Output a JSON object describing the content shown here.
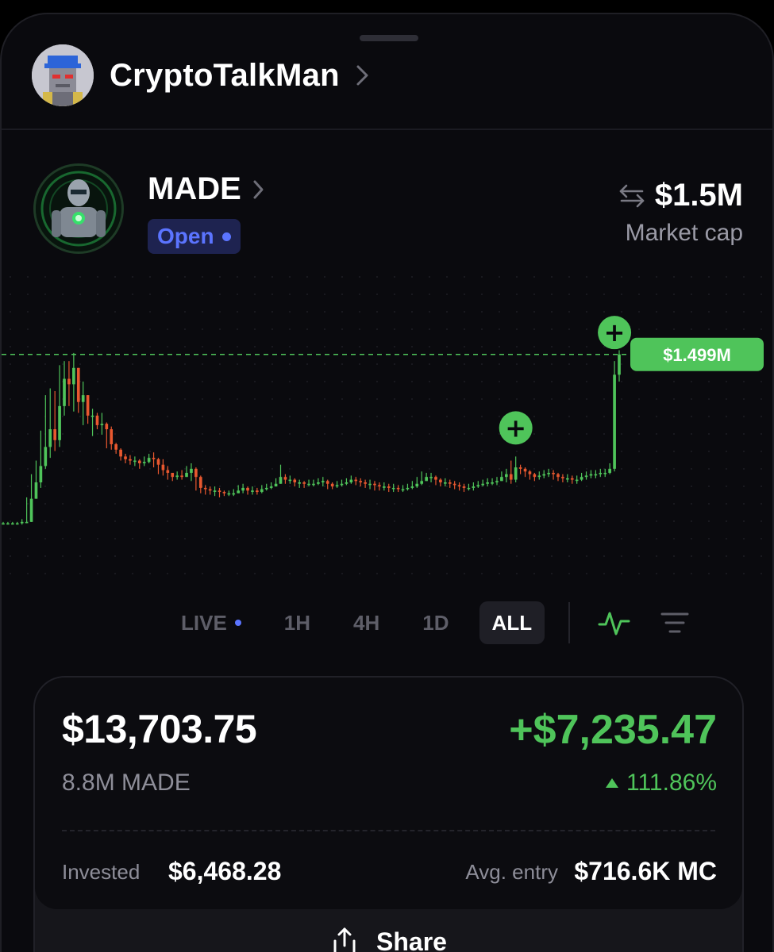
{
  "header": {
    "username": "CryptoTalkMan"
  },
  "token": {
    "ticker": "MADE",
    "status": "Open",
    "market_cap": "$1.5M",
    "market_cap_label": "Market cap"
  },
  "chart_data": {
    "type": "candlestick",
    "current_price_label": "$1.499M",
    "current_price": 1.499,
    "buy_markers": [
      {
        "index": 109,
        "label": "+"
      },
      {
        "index": 130,
        "label": "+"
      }
    ],
    "close": [
      0.26,
      0.26,
      0.26,
      0.26,
      0.27,
      0.27,
      0.44,
      0.56,
      0.68,
      0.82,
      0.95,
      0.87,
      1.12,
      1.32,
      1.28,
      1.4,
      1.15,
      1.2,
      1.05,
      1.05,
      0.98,
      0.99,
      0.95,
      0.84,
      0.8,
      0.75,
      0.73,
      0.72,
      0.72,
      0.7,
      0.71,
      0.74,
      0.73,
      0.69,
      0.65,
      0.63,
      0.6,
      0.61,
      0.6,
      0.63,
      0.66,
      0.6,
      0.52,
      0.51,
      0.5,
      0.5,
      0.49,
      0.48,
      0.48,
      0.48,
      0.5,
      0.52,
      0.5,
      0.5,
      0.49,
      0.51,
      0.52,
      0.53,
      0.55,
      0.6,
      0.58,
      0.58,
      0.56,
      0.56,
      0.55,
      0.55,
      0.55,
      0.56,
      0.57,
      0.55,
      0.53,
      0.54,
      0.55,
      0.56,
      0.58,
      0.57,
      0.56,
      0.55,
      0.55,
      0.54,
      0.53,
      0.53,
      0.52,
      0.52,
      0.51,
      0.51,
      0.52,
      0.53,
      0.55,
      0.57,
      0.6,
      0.6,
      0.58,
      0.56,
      0.56,
      0.55,
      0.54,
      0.53,
      0.52,
      0.52,
      0.53,
      0.54,
      0.55,
      0.56,
      0.56,
      0.57,
      0.6,
      0.62,
      0.58,
      0.67,
      0.66,
      0.64,
      0.62,
      0.6,
      0.61,
      0.62,
      0.63,
      0.62,
      0.6,
      0.59,
      0.59,
      0.58,
      0.58,
      0.6,
      0.61,
      0.62,
      0.62,
      0.63,
      0.63,
      0.66,
      1.35,
      1.499
    ],
    "high": [
      0.27,
      0.27,
      0.27,
      0.27,
      0.29,
      0.45,
      0.62,
      0.72,
      0.94,
      1.2,
      1.25,
      1.23,
      1.42,
      1.45,
      1.45,
      1.51,
      1.34,
      1.3,
      1.18,
      1.1,
      1.07,
      1.07,
      1.0,
      0.97,
      0.85,
      0.81,
      0.77,
      0.76,
      0.75,
      0.73,
      0.75,
      0.77,
      0.78,
      0.74,
      0.73,
      0.68,
      0.63,
      0.64,
      0.65,
      0.68,
      0.7,
      0.67,
      0.61,
      0.54,
      0.53,
      0.53,
      0.52,
      0.5,
      0.5,
      0.51,
      0.54,
      0.55,
      0.53,
      0.53,
      0.52,
      0.54,
      0.55,
      0.56,
      0.59,
      0.69,
      0.62,
      0.61,
      0.59,
      0.58,
      0.57,
      0.58,
      0.58,
      0.59,
      0.6,
      0.58,
      0.56,
      0.57,
      0.58,
      0.59,
      0.61,
      0.6,
      0.59,
      0.58,
      0.58,
      0.57,
      0.56,
      0.56,
      0.55,
      0.55,
      0.54,
      0.54,
      0.55,
      0.57,
      0.6,
      0.64,
      0.63,
      0.63,
      0.61,
      0.59,
      0.59,
      0.58,
      0.57,
      0.56,
      0.55,
      0.55,
      0.56,
      0.57,
      0.58,
      0.59,
      0.59,
      0.6,
      0.64,
      0.66,
      0.72,
      0.75,
      0.69,
      0.67,
      0.65,
      0.63,
      0.64,
      0.65,
      0.66,
      0.65,
      0.63,
      0.62,
      0.62,
      0.61,
      0.61,
      0.63,
      0.64,
      0.65,
      0.65,
      0.66,
      0.66,
      0.7,
      1.45,
      1.53
    ],
    "low": [
      0.25,
      0.25,
      0.25,
      0.25,
      0.25,
      0.26,
      0.3,
      0.44,
      0.52,
      0.66,
      0.74,
      0.79,
      0.82,
      1.05,
      1.12,
      1.08,
      1.07,
      0.98,
      0.99,
      0.9,
      0.95,
      0.91,
      0.81,
      0.8,
      0.77,
      0.72,
      0.7,
      0.69,
      0.68,
      0.66,
      0.68,
      0.7,
      0.67,
      0.62,
      0.61,
      0.58,
      0.57,
      0.58,
      0.58,
      0.6,
      0.57,
      0.5,
      0.48,
      0.47,
      0.47,
      0.46,
      0.45,
      0.46,
      0.46,
      0.46,
      0.48,
      0.48,
      0.47,
      0.47,
      0.47,
      0.48,
      0.5,
      0.51,
      0.53,
      0.55,
      0.55,
      0.55,
      0.53,
      0.52,
      0.52,
      0.53,
      0.53,
      0.54,
      0.53,
      0.51,
      0.51,
      0.52,
      0.53,
      0.54,
      0.55,
      0.54,
      0.53,
      0.52,
      0.51,
      0.5,
      0.5,
      0.5,
      0.49,
      0.49,
      0.49,
      0.49,
      0.5,
      0.51,
      0.52,
      0.54,
      0.57,
      0.56,
      0.54,
      0.53,
      0.53,
      0.52,
      0.51,
      0.5,
      0.49,
      0.5,
      0.5,
      0.52,
      0.53,
      0.53,
      0.54,
      0.54,
      0.57,
      0.56,
      0.55,
      0.56,
      0.62,
      0.6,
      0.58,
      0.57,
      0.58,
      0.59,
      0.6,
      0.58,
      0.57,
      0.56,
      0.56,
      0.55,
      0.55,
      0.57,
      0.58,
      0.59,
      0.59,
      0.6,
      0.6,
      0.62,
      0.64,
      1.3
    ]
  },
  "timeframes": {
    "live": "LIVE",
    "h1": "1H",
    "h4": "4H",
    "d1": "1D",
    "all": "ALL",
    "active": "ALL"
  },
  "position": {
    "value": "$13,703.75",
    "pnl": "+$7,235.47",
    "holdings": "8.8M MADE",
    "pnl_pct": "111.86%",
    "invested_label": "Invested",
    "invested_value": "$6,468.28",
    "avg_entry_label": "Avg. entry",
    "avg_entry_value": "$716.6K MC"
  },
  "share": {
    "label": "Share"
  },
  "colors": {
    "up": "#4fc45a",
    "down": "#e8582f",
    "accent": "#5b74ff",
    "background": "#0a0a0e"
  },
  "icons": {
    "profile_chevron": "chevron-right-icon",
    "swap": "swap-arrows-icon",
    "line_chart_toggle": "line-chart-icon",
    "filter": "filter-lines-icon",
    "share": "share-upload-icon"
  }
}
